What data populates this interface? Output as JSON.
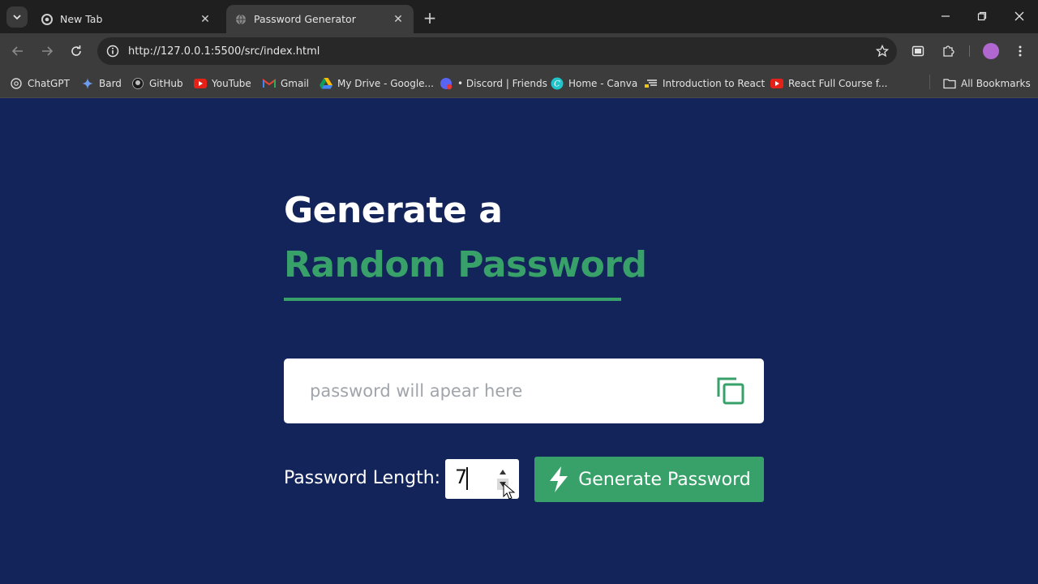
{
  "browser": {
    "tabs": [
      {
        "title": "New Tab",
        "active": false,
        "icon": "chrome-icon"
      },
      {
        "title": "Password Generator",
        "active": true,
        "icon": "globe-icon"
      }
    ],
    "url": "http://127.0.0.1:5500/src/index.html",
    "bookmarks": [
      {
        "label": "ChatGPT",
        "icon": "chatgpt-icon"
      },
      {
        "label": "Bard",
        "icon": "bard-sparkle-icon"
      },
      {
        "label": "GitHub",
        "icon": "github-icon"
      },
      {
        "label": "YouTube",
        "icon": "youtube-icon"
      },
      {
        "label": "Gmail",
        "icon": "gmail-icon"
      },
      {
        "label": "My Drive - Google...",
        "icon": "drive-icon"
      },
      {
        "label": "• Discord | Friends",
        "icon": "discord-icon"
      },
      {
        "label": "Home - Canva",
        "icon": "canva-icon"
      },
      {
        "label": "Introduction to React",
        "icon": "doc-icon"
      },
      {
        "label": "React Full Course f...",
        "icon": "youtube-icon"
      }
    ],
    "all_bookmarks_label": "All Bookmarks"
  },
  "page": {
    "heading_line1": "Generate a",
    "heading_line2": "Random Password",
    "password_placeholder": "password will apear here",
    "length_label": "Password Length:",
    "length_value": "7",
    "generate_button_label": "Generate Password"
  },
  "colors": {
    "background": "#13245a",
    "accent": "#38a169",
    "text": "#ffffff"
  }
}
